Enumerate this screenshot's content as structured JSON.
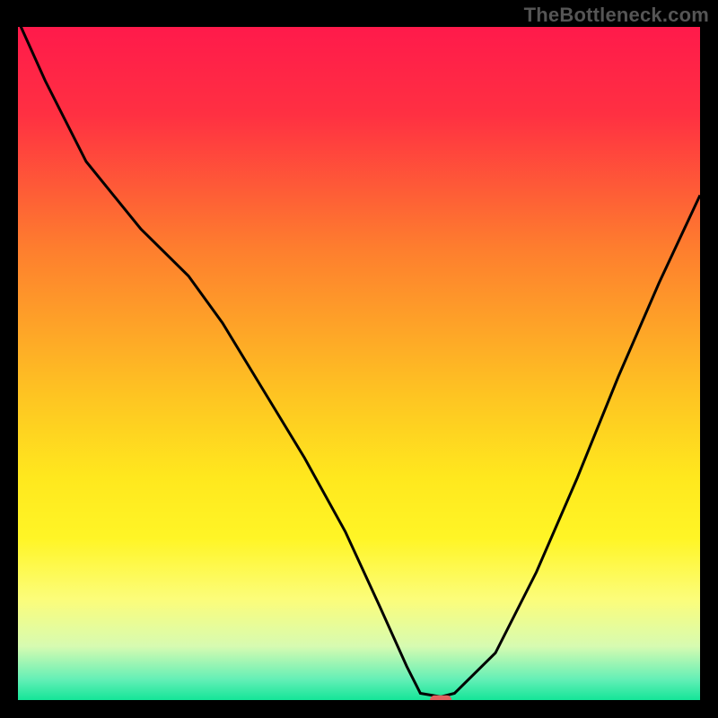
{
  "watermark": "TheBottleneck.com",
  "chart_data": {
    "type": "line",
    "title": "",
    "xlabel": "",
    "ylabel": "",
    "xlim": [
      0,
      100
    ],
    "ylim": [
      0,
      100
    ],
    "grid": false,
    "background_gradient": {
      "stops": [
        {
          "offset": 0,
          "color": "#ff1a4b"
        },
        {
          "offset": 13,
          "color": "#ff3042"
        },
        {
          "offset": 33,
          "color": "#fe7e2e"
        },
        {
          "offset": 55,
          "color": "#fec522"
        },
        {
          "offset": 67,
          "color": "#ffe81e"
        },
        {
          "offset": 76,
          "color": "#fff526"
        },
        {
          "offset": 85,
          "color": "#fcfd7a"
        },
        {
          "offset": 92,
          "color": "#d7fbb1"
        },
        {
          "offset": 97,
          "color": "#62efb6"
        },
        {
          "offset": 100,
          "color": "#14e598"
        }
      ]
    },
    "series": [
      {
        "name": "bottleneck-curve",
        "color": "#000000",
        "x": [
          0,
          4,
          10,
          18,
          25,
          30,
          36,
          42,
          48,
          53,
          57,
          59,
          62,
          64,
          70,
          76,
          82,
          88,
          94,
          100
        ],
        "y": [
          101,
          92,
          80,
          70,
          63,
          56,
          46,
          36,
          25,
          14,
          5,
          1,
          0.5,
          1,
          7,
          19,
          33,
          48,
          62,
          75
        ]
      }
    ],
    "marker": {
      "shape": "pill",
      "x": 62,
      "y": 0,
      "width_pct": 3.2,
      "height_pct": 1.4,
      "color": "#e0615e"
    }
  }
}
